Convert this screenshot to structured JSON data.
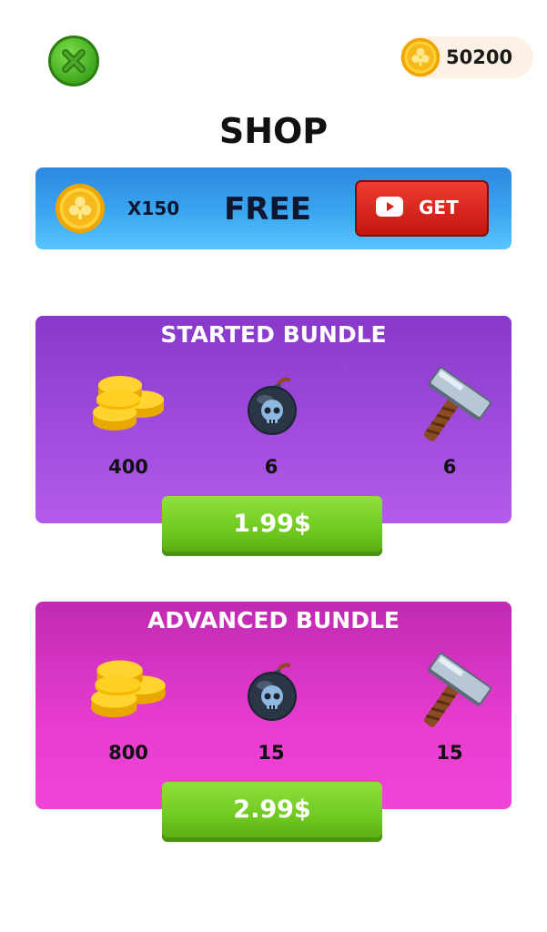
{
  "header": {
    "close_icon": "close-icon",
    "balance": "50200",
    "balance_icon": "clover-coin-icon"
  },
  "title": "SHOP",
  "free_offer": {
    "coin_icon": "clover-coin-icon",
    "quantity": "X150",
    "label": "FREE",
    "button_icon": "video-play-icon",
    "button_label": "GET"
  },
  "bundles": [
    {
      "title": "STARTED BUNDLE",
      "items": [
        {
          "icon": "coin-stack-icon",
          "quantity": "400"
        },
        {
          "icon": "skull-bomb-icon",
          "quantity": "6"
        },
        {
          "icon": "hammer-icon",
          "quantity": "6"
        }
      ],
      "price": "1.99$"
    },
    {
      "title": "ADVANCED BUNDLE",
      "items": [
        {
          "icon": "coin-stack-icon",
          "quantity": "800"
        },
        {
          "icon": "skull-bomb-icon",
          "quantity": "15"
        },
        {
          "icon": "hammer-icon",
          "quantity": "15"
        }
      ],
      "price": "2.99$"
    }
  ],
  "colors": {
    "banner_blue": "#3aa6f0",
    "get_red": "#d92a20",
    "starter_purple": "#a24ee0",
    "advanced_magenta": "#e83dd0",
    "buy_green": "#78cc22",
    "coin_gold": "#f7c01a"
  }
}
